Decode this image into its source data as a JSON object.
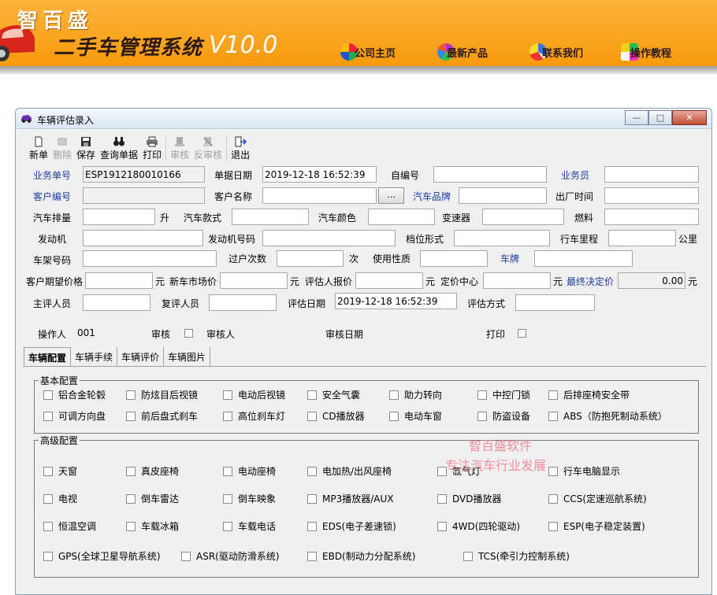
{
  "banner": {
    "brand": "智百盛",
    "system_name": "二手车管理系统",
    "version": "V10.0",
    "nav": [
      {
        "label": "公司主页",
        "icon": "company-home-icon"
      },
      {
        "label": "最新产品",
        "icon": "new-products-icon"
      },
      {
        "label": "联系我们",
        "icon": "contact-us-icon"
      },
      {
        "label": "操作教程",
        "icon": "tutorial-icon"
      }
    ]
  },
  "window": {
    "title": "车辆评估录入",
    "minimize": "—",
    "maximize": "□",
    "close": "✕"
  },
  "toolbar": {
    "new": "新单",
    "delete": "删除",
    "save": "保存",
    "query": "查询单据",
    "print": "打印",
    "review": "审核",
    "unreview": "反审核",
    "exit": "退出"
  },
  "form": {
    "business_no_label": "业务单号",
    "business_no": "ESP1912180010166",
    "doc_date_label": "单据日期",
    "doc_date": "2019-12-18 16:52:39",
    "self_no_label": "自编号",
    "self_no": "",
    "salesperson_label": "业务员",
    "salesperson": "",
    "customer_no_label": "客户编号",
    "customer_no": "",
    "customer_name_label": "客户名称",
    "customer_name": "",
    "browse": "...",
    "car_brand_label": "汽车品牌",
    "car_brand": "",
    "factory_date_label": "出厂时间",
    "factory_date": "",
    "displacement_label": "汽车排量",
    "displacement_unit": "升",
    "model_label": "汽车款式",
    "color_label": "汽车颜色",
    "gearbox_label": "变速器",
    "fuel_label": "燃料",
    "engine_label": "发动机",
    "engine_no_label": "发动机号码",
    "gear_type_label": "档位形式",
    "mileage_label": "行车里程",
    "mileage_unit": "公里",
    "vin_label": "车架号码",
    "transfer_label": "过户次数",
    "transfer_unit": "次",
    "usage_label": "使用性质",
    "plate_label": "车牌",
    "expected_price_label": "客户期望价格",
    "new_price_label": "新车市场价",
    "appraiser_quote_label": "评估人报价",
    "pricing_center_label": "定价中心",
    "final_price_label": "最终决定价",
    "final_price": "0.00",
    "currency": "元",
    "chief_appraiser_label": "主评人员",
    "second_appraiser_label": "复评人员",
    "eval_date_label": "评估日期",
    "eval_date": "2019-12-18 16:52:39",
    "eval_method_label": "评估方式",
    "operator_label": "操作人",
    "operator": "001",
    "review_label": "审核",
    "reviewer_label": "审核人",
    "review_date_label": "审核日期",
    "print_label": "打印"
  },
  "tabs": [
    "车辆配置",
    "车辆手续",
    "车辆评价",
    "车辆图片"
  ],
  "basic_config": {
    "title": "基本配置",
    "items": [
      "铝合金轮毂",
      "防炫目后视镜",
      "电动后视镜",
      "安全气囊",
      "助力转向",
      "中控门锁",
      "后排座椅安全带",
      "可调方向盘",
      "前后盘式刹车",
      "高位刹车灯",
      "CD播放器",
      "电动车窗",
      "防盗设备",
      "ABS（防抱死制动系统）"
    ]
  },
  "advanced_config": {
    "title": "高级配置",
    "items": [
      "天窗",
      "真皮座椅",
      "电动座椅",
      "电加热/出风座椅",
      "氙气灯",
      "行车电脑显示",
      "电视",
      "倒车雷达",
      "倒车映象",
      "MP3播放器/AUX",
      "DVD播放器",
      "CCS(定速巡航系统)",
      "恒温空调",
      "车载冰箱",
      "车载电话",
      "EDS(电子差速锁)",
      "4WD(四轮驱动)",
      "ESP(电子稳定装置)",
      "GPS(全球卫星导航系统)",
      "ASR(驱动防滑系统)",
      "EBD(制动力分配系统)",
      "TCS(牵引力控制系统)"
    ]
  },
  "watermark": {
    "line1": "智百盛软件",
    "line2": "专注汽车行业发展"
  }
}
